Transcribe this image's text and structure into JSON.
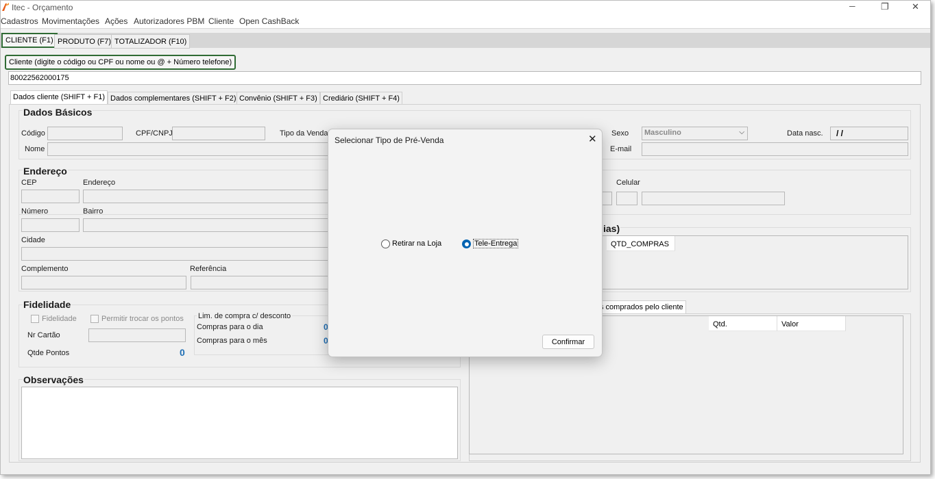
{
  "window": {
    "title": "Itec - Orçamento",
    "app_icon": "itec-logo-icon",
    "controls": {
      "minimize": "─",
      "maximize": "❐",
      "close": "✕"
    }
  },
  "menu": [
    "Cadastros",
    "Movimentações",
    "Ações",
    "Autorizadores PBM",
    "Cliente",
    "Open CashBack"
  ],
  "main_tabs": [
    "CLIENTE (F1)",
    "PRODUTO (F7)",
    "TOTALIZADOR (F10)"
  ],
  "client_search": {
    "label": "Cliente (digite o código ou CPF ou nome ou @ + Número telefone)",
    "value": "80022562000175"
  },
  "sub_tabs": [
    "Dados cliente (SHIFT + F1)",
    "Dados complementares (SHIFT + F2)",
    "Convênio (SHIFT + F3)",
    "Crediário (SHIFT + F4)"
  ],
  "basic": {
    "title": "Dados Básicos",
    "codigo": "Código",
    "cpf": "CPF/CNPJ",
    "tipo_venda": "Tipo da Venda",
    "sexo": "Sexo",
    "sexo_value": "Masculino",
    "data_nasc": "Data nasc.",
    "data_nasc_value": "/ /",
    "nome": "Nome",
    "email": "E-mail"
  },
  "address": {
    "title": "Endereço",
    "cep": "CEP",
    "endereco": "Endereço",
    "numero": "Número",
    "bairro": "Bairro",
    "cidade": "Cidade",
    "complemento": "Complemento",
    "referencia": "Referência",
    "celular": "Celular"
  },
  "right_panel": {
    "partial_title": "ias)",
    "col_qtd_compras": "QTD_COMPRAS",
    "partial_tab": "s comprados pelo cliente",
    "col_qtd": "Qtd.",
    "col_valor": "Valor"
  },
  "fidelity": {
    "title": "Fidelidade",
    "fidelidade": "Fidelidade",
    "permitir": "Permitir trocar os pontos",
    "nr_cartao": "Nr Cartão",
    "qtde_pontos": "Qtde Pontos",
    "qtde_pontos_value": "0",
    "lim_title": "Lim. de compra c/ desconto",
    "compras_dia": "Compras para o dia",
    "compras_dia_value": "0",
    "compras_mes": "Compras para o mês",
    "compras_mes_value": "0"
  },
  "observacoes": {
    "title": "Observações"
  },
  "dialog": {
    "title": "Selecionar Tipo de Pré-Venda",
    "close": "✕",
    "option_1": "Retirar na Loja",
    "option_2": "Tele-Entrega",
    "selected": "Tele-Entrega",
    "confirm": "Confirmar"
  },
  "colors": {
    "accent_green": "#2f6b34",
    "radio_blue": "#0063b1",
    "number_blue": "#1f6fb5"
  }
}
